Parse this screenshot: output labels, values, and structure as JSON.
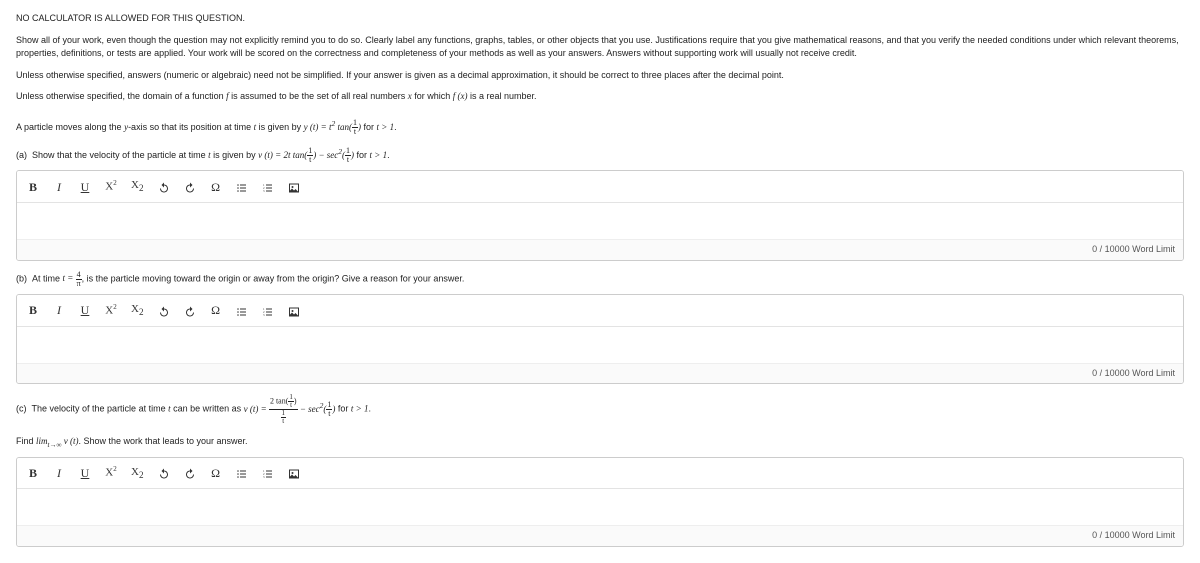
{
  "header": "NO CALCULATOR IS ALLOWED FOR THIS QUESTION.",
  "instr1": "Show all of your work, even though the question may not explicitly remind you to do so. Clearly label any functions, graphs, tables, or other objects that you use. Justifications require that you give mathematical reasons, and that you verify the needed conditions under which relevant theorems, properties, definitions, or tests are applied. Your work will be scored on the correctness and completeness of your methods as well as your answers. Answers without supporting work will usually not receive credit.",
  "instr2": "Unless otherwise specified, answers (numeric or algebraic) need not be simplified. If your answer is given as a decimal approximation, it should be correct to three places after the decimal point.",
  "instr3_a": "Unless otherwise specified, the domain of a function ",
  "instr3_b": " is assumed to be the set of all real numbers ",
  "instr3_c": " for which ",
  "instr3_d": " is a real number.",
  "stem_a": "A particle moves along the ",
  "stem_b": "-axis so that its position at time ",
  "stem_c": " is given by ",
  "stem_d": " for ",
  "parts": {
    "a": {
      "label": "(a)",
      "t1": "Show that the velocity of the particle at time ",
      "t2": " is given by ",
      "t3": " for "
    },
    "b": {
      "label": "(b)",
      "t1": "At time ",
      "t2": ", is the particle moving toward the origin or away from the origin? Give a reason for your answer."
    },
    "c": {
      "label": "(c)",
      "t1": "The velocity of the particle at time ",
      "t2": " can be written as ",
      "t3": " for ",
      "t4": "Find ",
      "t5": ". Show the work that leads to your answer."
    }
  },
  "toolbar": {
    "bold": "B",
    "italic": "I",
    "underline": "U",
    "sup": "X",
    "sub": "X",
    "undo": "↺",
    "redo": "↻",
    "omega": "Ω",
    "ul": "≡",
    "ol": "≡",
    "img": "▦"
  },
  "limit_text": "0 / 10000 Word Limit"
}
